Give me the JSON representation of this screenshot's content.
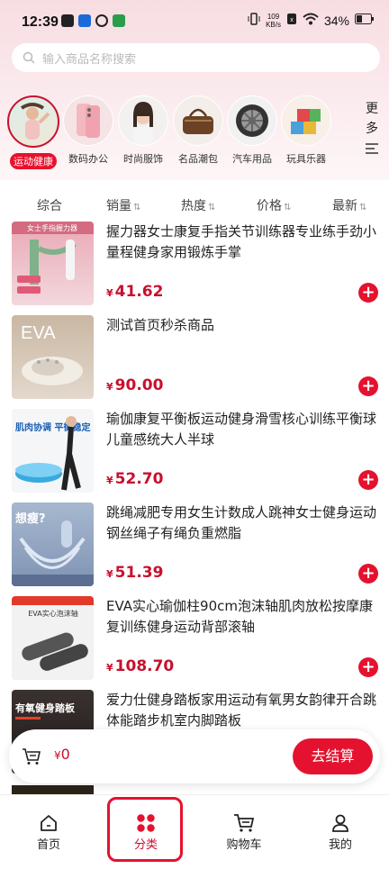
{
  "status": {
    "time": "12:39",
    "net_speed_top": "109",
    "net_speed_bottom": "KB/s",
    "battery": "34%"
  },
  "search": {
    "placeholder": "输入商品名称搜索"
  },
  "categories": [
    {
      "label": "运动健康",
      "icon": "fitness-woman"
    },
    {
      "label": "数码办公",
      "icon": "phone"
    },
    {
      "label": "时尚服饰",
      "icon": "fashion-woman"
    },
    {
      "label": "名品潮包",
      "icon": "handbag"
    },
    {
      "label": "汽车用品",
      "icon": "car-wheel"
    },
    {
      "label": "玩具乐器",
      "icon": "toy-blocks"
    }
  ],
  "more_label": "更多",
  "sort": [
    {
      "label": "综合"
    },
    {
      "label": "销量"
    },
    {
      "label": "热度"
    },
    {
      "label": "价格"
    },
    {
      "label": "最新"
    }
  ],
  "products": [
    {
      "title": "握力器女士康复手指关节训练器专业练手劲小量程健身家用锻炼手掌",
      "price": "41.62",
      "thumb_text": "女士手指握力器"
    },
    {
      "title": "测试首页秒杀商品",
      "price": "90.00",
      "thumb_text": "EVA"
    },
    {
      "title": "瑜伽康复平衡板运动健身滑雪核心训练平衡球儿童感统大人半球",
      "price": "52.70",
      "thumb_text": "肌肉协调 平衡稳定"
    },
    {
      "title": "跳绳减肥专用女生计数成人跳神女士健身运动钢丝绳子有绳负重燃脂",
      "price": "51.39",
      "thumb_text": "想瘦?"
    },
    {
      "title": "EVA实心瑜伽柱90cm泡沫轴肌肉放松按摩康复训练健身运动背部滚轴",
      "price": "108.70",
      "thumb_text": "EVA实心泡沫轴"
    },
    {
      "title": "爱力仕健身踏板家用运动有氧男女韵律开合跳体能踏步机室内脚踏板",
      "price": "",
      "thumb_text": "有氧健身踏板"
    }
  ],
  "cart": {
    "currency": "¥",
    "amount": "0",
    "checkout_label": "去结算"
  },
  "tabs": [
    {
      "label": "首页"
    },
    {
      "label": "分类"
    },
    {
      "label": "购物车"
    },
    {
      "label": "我的"
    }
  ],
  "colors": {
    "accent": "#e4122f",
    "price": "#c8102e"
  }
}
